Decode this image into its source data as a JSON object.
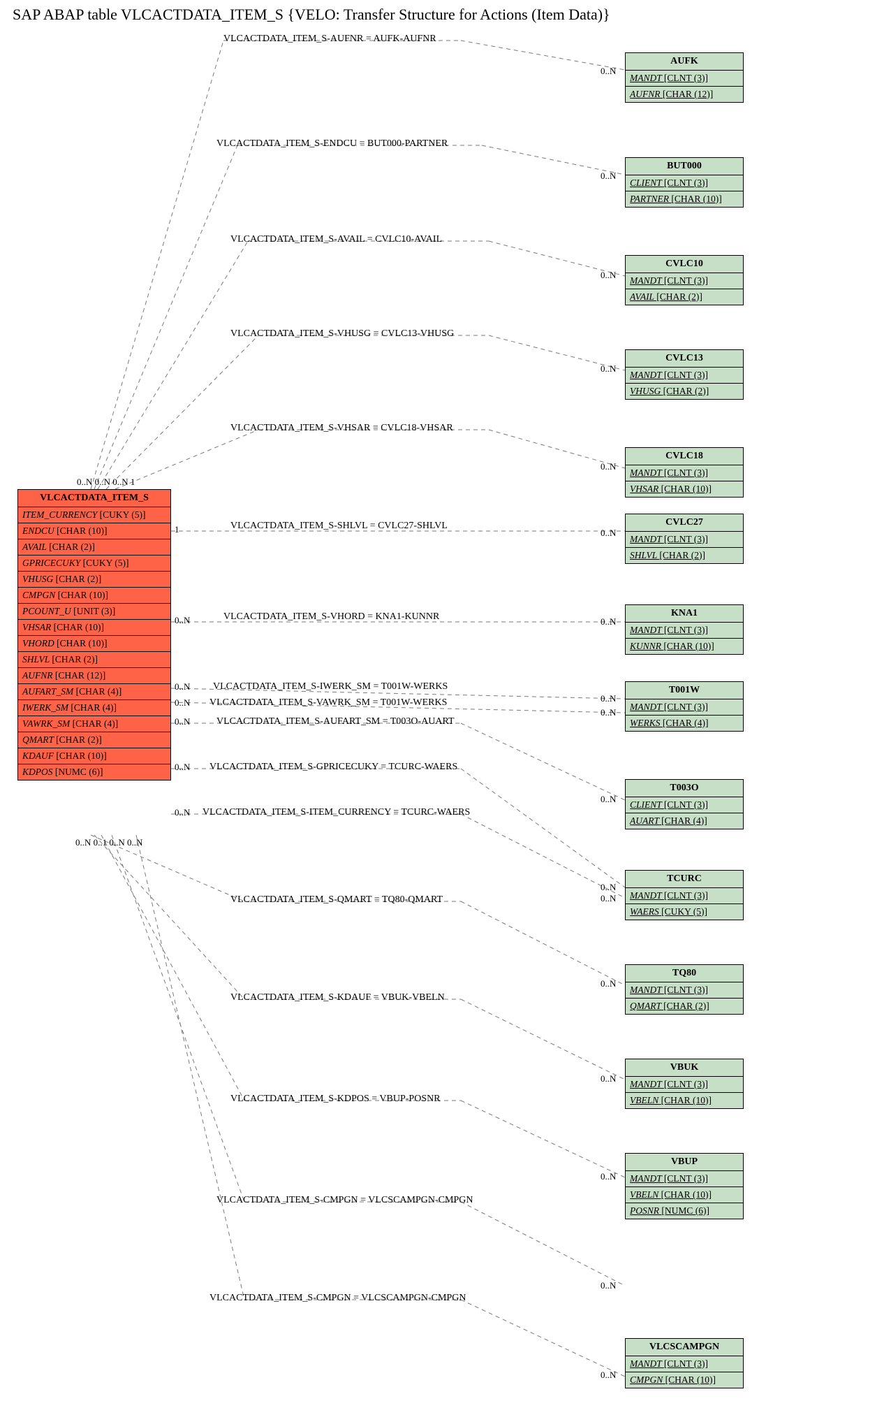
{
  "title": "SAP ABAP table VLCACTDATA_ITEM_S {VELO: Transfer Structure for Actions (Item Data)}",
  "main_entity": {
    "name": "VLCACTDATA_ITEM_S",
    "fields": [
      {
        "name": "ITEM_CURRENCY",
        "type": "[CUKY (5)]"
      },
      {
        "name": "ENDCU",
        "type": "[CHAR (10)]"
      },
      {
        "name": "AVAIL",
        "type": "[CHAR (2)]"
      },
      {
        "name": "GPRICECUKY",
        "type": "[CUKY (5)]"
      },
      {
        "name": "VHUSG",
        "type": "[CHAR (2)]"
      },
      {
        "name": "CMPGN",
        "type": "[CHAR (10)]"
      },
      {
        "name": "PCOUNT_U",
        "type": "[UNIT (3)]"
      },
      {
        "name": "VHSAR",
        "type": "[CHAR (10)]"
      },
      {
        "name": "VHORD",
        "type": "[CHAR (10)]"
      },
      {
        "name": "SHLVL",
        "type": "[CHAR (2)]"
      },
      {
        "name": "AUFNR",
        "type": "[CHAR (12)]"
      },
      {
        "name": "AUFART_SM",
        "type": "[CHAR (4)]"
      },
      {
        "name": "IWERK_SM",
        "type": "[CHAR (4)]"
      },
      {
        "name": "VAWRK_SM",
        "type": "[CHAR (4)]"
      },
      {
        "name": "QMART",
        "type": "[CHAR (2)]"
      },
      {
        "name": "KDAUF",
        "type": "[CHAR (10)]"
      },
      {
        "name": "KDPOS",
        "type": "[NUMC (6)]"
      }
    ]
  },
  "ref_entities": [
    {
      "name": "AUFK",
      "fields": [
        {
          "name": "MANDT",
          "type": "[CLNT (3)]",
          "pk": true
        },
        {
          "name": "AUFNR",
          "type": "[CHAR (12)]",
          "pk": true
        }
      ]
    },
    {
      "name": "BUT000",
      "fields": [
        {
          "name": "CLIENT",
          "type": "[CLNT (3)]",
          "pk": true
        },
        {
          "name": "PARTNER",
          "type": "[CHAR (10)]",
          "pk": true
        }
      ]
    },
    {
      "name": "CVLC10",
      "fields": [
        {
          "name": "MANDT",
          "type": "[CLNT (3)]",
          "pk": true
        },
        {
          "name": "AVAIL",
          "type": "[CHAR (2)]",
          "pk": true
        }
      ]
    },
    {
      "name": "CVLC13",
      "fields": [
        {
          "name": "MANDT",
          "type": "[CLNT (3)]",
          "pk": true
        },
        {
          "name": "VHUSG",
          "type": "[CHAR (2)]",
          "pk": true
        }
      ]
    },
    {
      "name": "CVLC18",
      "fields": [
        {
          "name": "MANDT",
          "type": "[CLNT (3)]",
          "pk": true
        },
        {
          "name": "VHSAR",
          "type": "[CHAR (10)]",
          "pk": true
        }
      ]
    },
    {
      "name": "CVLC27",
      "fields": [
        {
          "name": "MANDT",
          "type": "[CLNT (3)]",
          "pk": true
        },
        {
          "name": "SHLVL",
          "type": "[CHAR (2)]",
          "pk": true
        }
      ]
    },
    {
      "name": "KNA1",
      "fields": [
        {
          "name": "MANDT",
          "type": "[CLNT (3)]",
          "pk": true
        },
        {
          "name": "KUNNR",
          "type": "[CHAR (10)]",
          "pk": true
        }
      ]
    },
    {
      "name": "T001W",
      "fields": [
        {
          "name": "MANDT",
          "type": "[CLNT (3)]",
          "pk": true
        },
        {
          "name": "WERKS",
          "type": "[CHAR (4)]",
          "pk": true
        }
      ]
    },
    {
      "name": "T003O",
      "fields": [
        {
          "name": "CLIENT",
          "type": "[CLNT (3)]",
          "pk": true
        },
        {
          "name": "AUART",
          "type": "[CHAR (4)]",
          "pk": true
        }
      ]
    },
    {
      "name": "TCURC",
      "fields": [
        {
          "name": "MANDT",
          "type": "[CLNT (3)]",
          "pk": true
        },
        {
          "name": "WAERS",
          "type": "[CUKY (5)]",
          "pk": true
        }
      ]
    },
    {
      "name": "TQ80",
      "fields": [
        {
          "name": "MANDT",
          "type": "[CLNT (3)]",
          "pk": true
        },
        {
          "name": "QMART",
          "type": "[CHAR (2)]",
          "pk": true
        }
      ]
    },
    {
      "name": "VBUK",
      "fields": [
        {
          "name": "MANDT",
          "type": "[CLNT (3)]",
          "pk": true
        },
        {
          "name": "VBELN",
          "type": "[CHAR (10)]",
          "pk": true
        }
      ]
    },
    {
      "name": "VBUP",
      "fields": [
        {
          "name": "MANDT",
          "type": "[CLNT (3)]",
          "pk": true
        },
        {
          "name": "VBELN",
          "type": "[CHAR (10)]",
          "pk": true
        },
        {
          "name": "POSNR",
          "type": "[NUMC (6)]",
          "pk": true
        }
      ]
    },
    {
      "name": "VLCSCAMPGN",
      "fields": [
        {
          "name": "MANDT",
          "type": "[CLNT (3)]",
          "pk": true
        },
        {
          "name": "CMPGN",
          "type": "[CHAR (10)]",
          "pk": true
        }
      ]
    }
  ],
  "relations": [
    {
      "label": "VLCACTDATA_ITEM_S-AUFNR = AUFK-AUFNR",
      "card_src": "0..N",
      "card_tgt": "0..N"
    },
    {
      "label": "VLCACTDATA_ITEM_S-ENDCU = BUT000-PARTNER",
      "card_src": "0..N",
      "card_tgt": "0..N"
    },
    {
      "label": "VLCACTDATA_ITEM_S-AVAIL = CVLC10-AVAIL",
      "card_src": "0..N",
      "card_tgt": "0..N"
    },
    {
      "label": "VLCACTDATA_ITEM_S-VHUSG = CVLC13-VHUSG",
      "card_src": "0..N",
      "card_tgt": "0..N"
    },
    {
      "label": "VLCACTDATA_ITEM_S-VHSAR = CVLC18-VHSAR",
      "card_src": "1",
      "card_tgt": "0..N"
    },
    {
      "label": "VLCACTDATA_ITEM_S-SHLVL = CVLC27-SHLVL",
      "card_src": "1",
      "card_tgt": "0..N"
    },
    {
      "label": "VLCACTDATA_ITEM_S-VHORD = KNA1-KUNNR",
      "card_src": "0..N",
      "card_tgt": "0..N"
    },
    {
      "label": "VLCACTDATA_ITEM_S-IWERK_SM = T001W-WERKS",
      "card_src": "0..N",
      "card_tgt": "0..N"
    },
    {
      "label": "VLCACTDATA_ITEM_S-VAWRK_SM = T001W-WERKS",
      "card_src": "0..N",
      "card_tgt": "0..N"
    },
    {
      "label": "VLCACTDATA_ITEM_S-AUFART_SM = T003O-AUART",
      "card_src": "0..N",
      "card_tgt": "0..N"
    },
    {
      "label": "VLCACTDATA_ITEM_S-GPRICECUKY = TCURC-WAERS",
      "card_src": "0..N",
      "card_tgt": "0..N"
    },
    {
      "label": "VLCACTDATA_ITEM_S-ITEM_CURRENCY = TCURC-WAERS",
      "card_src": "0..N",
      "card_tgt": "0..N"
    },
    {
      "label": "VLCACTDATA_ITEM_S-QMART = TQ80-QMART",
      "card_src": "0..N",
      "card_tgt": "0..N"
    },
    {
      "label": "VLCACTDATA_ITEM_S-KDAUF = VBUK-VBELN",
      "card_src": "0..N",
      "card_tgt": "0..N"
    },
    {
      "label": "VLCACTDATA_ITEM_S-KDPOS = VBUP-POSNR",
      "card_src": "0..1",
      "card_tgt": "0..N"
    },
    {
      "label": "VLCACTDATA_ITEM_S-CMPGN = VLCSCAMPGN-CMPGN",
      "card_src": "0..N",
      "card_tgt": "0..N"
    }
  ],
  "card_labels": {
    "top_overlap": "0..N 0..N 0..N 1",
    "bottom_overlap": "0..N 0..1 0..N   0..N"
  }
}
